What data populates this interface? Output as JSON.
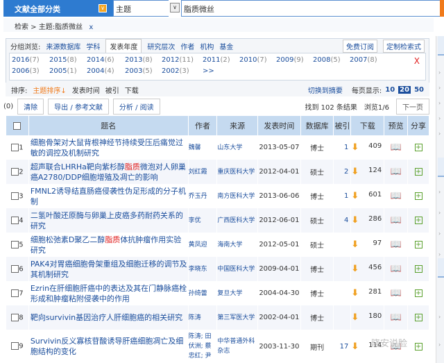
{
  "search": {
    "category": "文献全部分类",
    "field": "主题",
    "query": "脂质微丝"
  },
  "breadcrumb": {
    "root": "检索",
    "current": "主题:脂质微丝",
    "remove": "x"
  },
  "group": {
    "label": "分组浏览:",
    "tabs": [
      "来源数据库",
      "学科",
      "发表年度",
      "研究层次",
      "作者",
      "机构",
      "基金"
    ],
    "active": "发表年度",
    "subscribe": "免费订阅",
    "custom": "定制检索式",
    "close": "X",
    "years": [
      [
        "2016",
        "(7)"
      ],
      [
        "2015",
        "(8)"
      ],
      [
        "2014",
        "(6)"
      ],
      [
        "2013",
        "(8)"
      ],
      [
        "2012",
        "(11)"
      ],
      [
        "2011",
        "(2)"
      ],
      [
        "2010",
        "(7)"
      ],
      [
        "2009",
        "(9)"
      ],
      [
        "2008",
        "(5)"
      ],
      [
        "2007",
        "(8)"
      ],
      [
        "2006",
        "(3)"
      ],
      [
        "2005",
        "(1)"
      ],
      [
        "2004",
        "(4)"
      ],
      [
        "2003",
        "(5)"
      ],
      [
        "2002",
        "(3)"
      ]
    ],
    "more": ">>"
  },
  "sort": {
    "label": "排序:",
    "items": [
      "主题排序↓",
      "发表时间",
      "被引",
      "下载"
    ],
    "switch": "切换到摘要",
    "per_page_label": "每页显示:",
    "per_page": [
      "10",
      "20",
      "50"
    ],
    "selected": "20"
  },
  "actions": {
    "count": "(0)",
    "clear": "清除",
    "export": "导出 / 参考文献",
    "analyze": "分析 / 阅读",
    "found": "找到 102 条结果",
    "browse": "浏览1/6",
    "next": "下一页"
  },
  "table": {
    "headers": [
      "题名",
      "作者",
      "来源",
      "发表时间",
      "数据库",
      "被引",
      "下载",
      "预览",
      "分享"
    ],
    "rows": [
      {
        "n": "1",
        "pre": "细胞骨架对大鼠背根神经节持续受压后痛觉过敏的调控及机制研究",
        "hl": "",
        "post": "",
        "author": "魏馨",
        "source": "山东大学",
        "date": "2013-05-07",
        "db": "博士",
        "cite": "1",
        "dl": "409"
      },
      {
        "n": "2",
        "pre": "超声联合LHRHa靶向紫杉醇",
        "hl": "脂质",
        "post": "微泡对人卵巢癌A2780/DDP细胞增殖及凋亡的影响",
        "author": "刘红霞",
        "source": "重庆医科大学",
        "date": "2012-04-01",
        "db": "硕士",
        "cite": "2",
        "dl": "124"
      },
      {
        "n": "3",
        "pre": "FMNL2诱导结直肠癌侵袭性伪足形成的分子机制",
        "hl": "",
        "post": "",
        "author": "乔玉丹",
        "source": "南方医科大学",
        "date": "2013-06-06",
        "db": "博士",
        "cite": "1",
        "dl": "601"
      },
      {
        "n": "4",
        "pre": "二氢叶酸还原酶与卵巢上皮癌多药耐药关系的研究",
        "hl": "",
        "post": "",
        "author": "李优",
        "source": "广西医科大学",
        "date": "2012-06-01",
        "db": "硕士",
        "cite": "4",
        "dl": "286"
      },
      {
        "n": "5",
        "pre": "细胞松弛素D聚乙二醇",
        "hl": "脂质",
        "post": "体抗肿瘤作用实验研究",
        "author": "黄凤迎",
        "source": "海南大学",
        "date": "2012-05-01",
        "db": "硕士",
        "cite": "",
        "dl": "97"
      },
      {
        "n": "6",
        "pre": "PAK4对胃癌细胞骨架重组及细胞迁移的调节及其机制研究",
        "hl": "",
        "post": "",
        "author": "李晓东",
        "source": "中国医科大学",
        "date": "2009-04-01",
        "db": "博士",
        "cite": "",
        "dl": "456"
      },
      {
        "n": "7",
        "pre": "Ezrin在肝细胞肝癌中的表达及其在门静脉癌栓形成和肿瘤粘附侵袭中的作用",
        "hl": "",
        "post": "",
        "author": "孙绮蕾",
        "source": "复旦大学",
        "date": "2004-04-30",
        "db": "博士",
        "cite": "",
        "dl": "281"
      },
      {
        "n": "8",
        "pre": "靶向survivin基因治疗人肝细胞癌的相关研究",
        "hl": "",
        "post": "",
        "author": "陈涛",
        "source": "第三军医大学",
        "date": "2002-04-01",
        "db": "博士",
        "cite": "",
        "dl": "180"
      },
      {
        "n": "9",
        "pre": "Survivin反义寡核苷酸诱导肝癌细胞凋亡及细胞结构的变化",
        "hl": "",
        "post": "",
        "author": "陈涛; 田伏洲; 蔡忠红; 尹",
        "source": "中华普通外科杂志",
        "date": "2003-11-30",
        "db": "期刊",
        "cite": "17",
        "dl": "114"
      }
    ]
  },
  "watermark": "晓安说脸"
}
